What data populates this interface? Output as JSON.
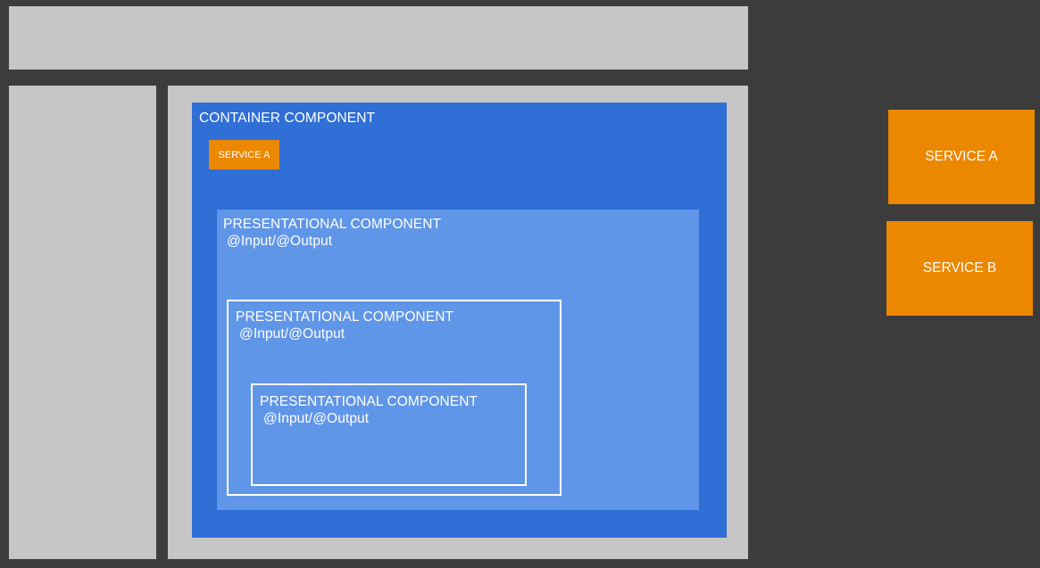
{
  "colors": {
    "background": "#3c3c3c",
    "panel": "#c6c6c6",
    "container": "#2f6fd6",
    "presentational": "#6096e8",
    "service": "#ec8700",
    "text": "#ffffff"
  },
  "container": {
    "title": "CONTAINER COMPONENT",
    "service_label": "SERVICE A"
  },
  "presentational": [
    {
      "title": "PRESENTATIONAL COMPONENT",
      "io": "@Input/@Output"
    },
    {
      "title": "PRESENTATIONAL COMPONENT",
      "io": "@Input/@Output"
    },
    {
      "title": "PRESENTATIONAL COMPONENT",
      "io": "@Input/@Output"
    }
  ],
  "services": [
    {
      "label": "SERVICE A"
    },
    {
      "label": "SERVICE B"
    }
  ]
}
